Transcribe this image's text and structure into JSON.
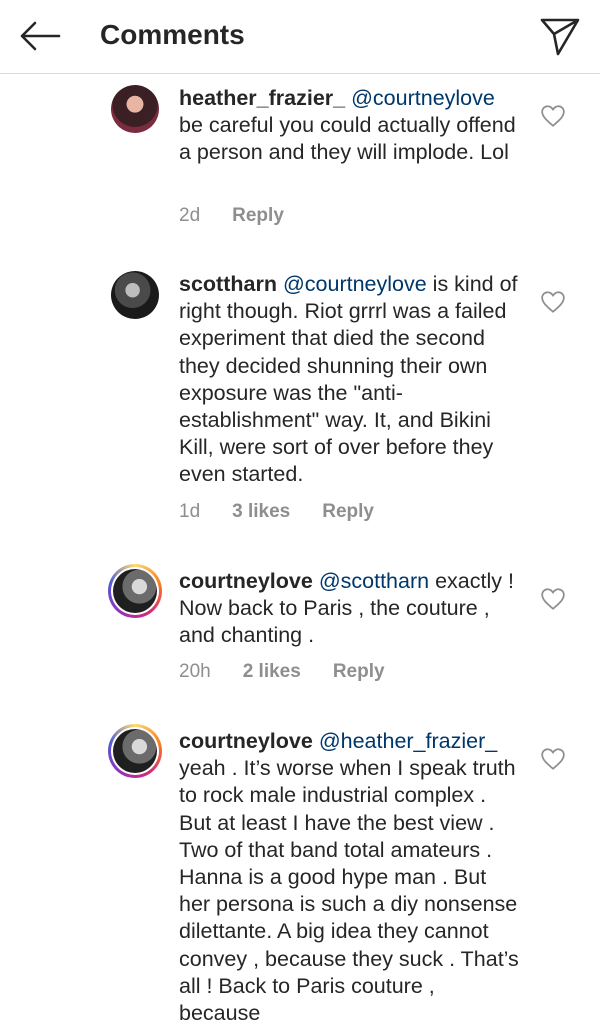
{
  "header": {
    "title": "Comments",
    "back_icon": "arrow-left-icon",
    "share_icon": "send-icon"
  },
  "colors": {
    "text": "#262626",
    "secondary": "#8e8e8e",
    "mention": "#00376b",
    "divider": "#dbdbdb"
  },
  "comments": [
    {
      "username": "heather_frazier_",
      "mention": "@courtneylove",
      "text": "be careful you could actually offend a person and they will implode. Lol",
      "time": "2d",
      "likes": "",
      "reply_label": "Reply"
    },
    {
      "username": "scottharn",
      "mention": "@courtneylove",
      "text": "is kind of right though. Riot grrrl was a failed experiment that died the second they decided shunning their own exposure was the \"anti-establishment\" way. It, and Bikini Kill, were sort of over before they even started.",
      "time": "1d",
      "likes": "3 likes",
      "reply_label": "Reply"
    },
    {
      "username": "courtneylove",
      "mention": "@scottharn",
      "text": "exactly ! Now back to Paris , the couture , and chanting .",
      "time": "20h",
      "likes": "2 likes",
      "reply_label": "Reply"
    },
    {
      "username": "courtneylove",
      "mention": "@heather_frazier_",
      "text": "yeah . It’s worse when I speak truth to rock male industrial complex . But at least I have the best view . Two of that band total amateurs . Hanna is a good hype man . But her persona  is such a diy nonsense dilettante. A big idea they cannot convey , because they suck . That’s all ! Back to Paris couture , because",
      "time": "",
      "likes": "",
      "reply_label": ""
    }
  ]
}
